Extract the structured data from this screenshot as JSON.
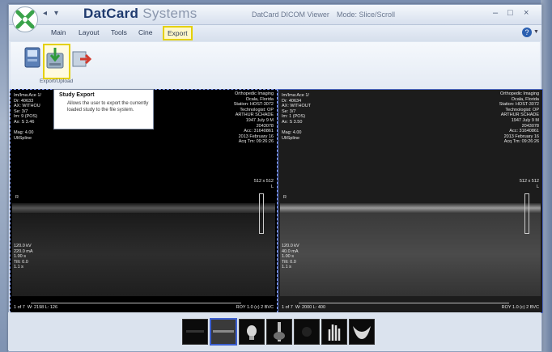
{
  "app": {
    "brand_bold": "DatCard",
    "brand_light": "Systems",
    "window_title": "DatCard DICOM Viewer",
    "mode": "Mode: Slice/Scroll",
    "quick_access": [
      "◂",
      "▾"
    ],
    "window_controls": [
      "–",
      "□",
      "×"
    ]
  },
  "menu": {
    "items": [
      "Main",
      "Layout",
      "Tools",
      "Cine",
      "Export"
    ],
    "active": "Export",
    "help_label": "?"
  },
  "ribbon": {
    "group_label": "Export/Upload",
    "buttons": [
      {
        "icon": "disc-export-icon"
      },
      {
        "icon": "study-export-icon",
        "selected": true
      },
      {
        "icon": "upload-arrow-icon"
      }
    ]
  },
  "tooltip": {
    "title": "Study Export",
    "body": "Allows the user to export the currently loaded study to the file system."
  },
  "viewport_left": {
    "top_left": "Im/Ima:Ace 1/\nDr: 40633\nAX: WITHOU\nSe: 3/7\nIm: 9 (POS)\nAx: S 3.46\n\nMag: 4.00\nUltSpline",
    "top_right": "Orthopedic Imaging\nOcala, Florida\nStation: HOST-3072\nTechnologist: OP\nARTHUR SCHADE\n1947 July 9 M\n2043078\nAcc: 31640861\n2013 February 16\nAcq Tm: 09:26:26",
    "right_value": "512 x 512\nL",
    "left_marker": "R",
    "bottom_left": "120.0 kV\n220.0 mA\n1.00 s\nTilt: 0.0\n1.1 s",
    "bottom_strip": "1 of 7  W: 2198 L: 126",
    "bottom_right": "ROY 1.0 (c) 2 BVC"
  },
  "viewport_right": {
    "top_left": "Im/Ima:Ace 1/\nDr: 40634\nAX: WITHOUT\nSe: 3/7\nIm: 1 (POS)\nAx: S 3.50\n\nMag: 4.00\nUltSpline",
    "top_right": "Orthopedic Imaging\nOcala, Florida\nStation: HOST-3072\nTechnologist: OP\nARTHUR SCHADE\n1947 July 9 M\n2043078\nAcc: 31640861\n2013 February 16\nAcq Tm: 09:26:26",
    "right_value": "512 x 512\nL",
    "left_marker": "R",
    "bottom_left": "120.0 kV\n40.0 mA\n1.00 s\nTilt: 0.0\n1.1 s",
    "bottom_strip": "1 of 7  W: 2000 L: 400",
    "bottom_right": "ROY 1.0 (c) 2 BVC"
  },
  "thumbnails": [
    {
      "icon": "ct-dark-thumb"
    },
    {
      "icon": "ct-slice-thumb",
      "selected": true
    },
    {
      "icon": "skull-thumb"
    },
    {
      "icon": "spine-thumb"
    },
    {
      "icon": "dark-thumb"
    },
    {
      "icon": "hand-thumb"
    },
    {
      "icon": "pelvis-thumb"
    }
  ],
  "colors": {
    "highlight": "#e4d000",
    "selection": "#3c5fd0",
    "brand": "#1f3a6e"
  }
}
